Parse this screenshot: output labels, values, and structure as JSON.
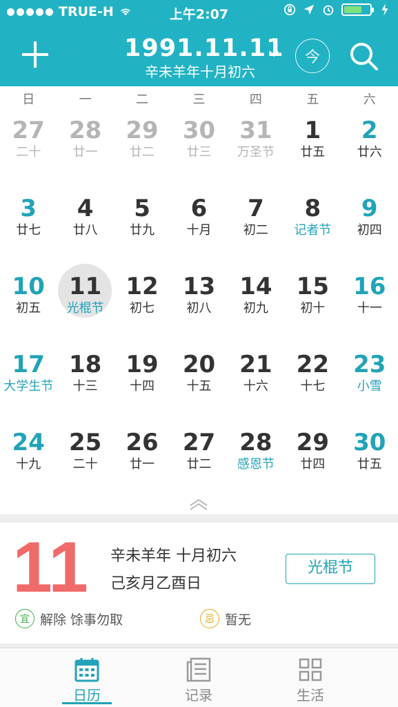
{
  "status_bar": {
    "carrier": "TRUE-H",
    "time": "上午2:07"
  },
  "header": {
    "date": "1991.11.11",
    "lunar": "辛未羊年十月初六",
    "today_label": "今"
  },
  "weekdays": [
    "日",
    "一",
    "二",
    "三",
    "四",
    "五",
    "六"
  ],
  "calendar": {
    "rows": [
      [
        {
          "n": "27",
          "s": "二十",
          "style": "gray"
        },
        {
          "n": "28",
          "s": "廿一",
          "style": "gray"
        },
        {
          "n": "29",
          "s": "廿二",
          "style": "gray"
        },
        {
          "n": "30",
          "s": "廿三",
          "style": "gray"
        },
        {
          "n": "31",
          "s": "万圣节",
          "style": "gray"
        },
        {
          "n": "1",
          "s": "廿五",
          "style": "dark"
        },
        {
          "n": "2",
          "s": "廿六",
          "style": "teal",
          "sub_dark": true
        }
      ],
      [
        {
          "n": "3",
          "s": "廿七",
          "style": "teal",
          "sub_dark": true
        },
        {
          "n": "4",
          "s": "廿八",
          "style": "dark"
        },
        {
          "n": "5",
          "s": "廿九",
          "style": "dark"
        },
        {
          "n": "6",
          "s": "十月",
          "style": "dark"
        },
        {
          "n": "7",
          "s": "初二",
          "style": "dark"
        },
        {
          "n": "8",
          "s": "记者节",
          "style": "dark",
          "sub_teal": true
        },
        {
          "n": "9",
          "s": "初四",
          "style": "teal",
          "sub_dark": true
        }
      ],
      [
        {
          "n": "10",
          "s": "初五",
          "style": "teal",
          "sub_dark": true
        },
        {
          "n": "11",
          "s": "光棍节",
          "style": "dark",
          "sub_teal": true,
          "selected": true
        },
        {
          "n": "12",
          "s": "初七",
          "style": "dark"
        },
        {
          "n": "13",
          "s": "初八",
          "style": "dark"
        },
        {
          "n": "14",
          "s": "初九",
          "style": "dark"
        },
        {
          "n": "15",
          "s": "初十",
          "style": "dark"
        },
        {
          "n": "16",
          "s": "十一",
          "style": "teal",
          "sub_dark": true
        }
      ],
      [
        {
          "n": "17",
          "s": "大学生节",
          "style": "teal"
        },
        {
          "n": "18",
          "s": "十三",
          "style": "dark"
        },
        {
          "n": "19",
          "s": "十四",
          "style": "dark"
        },
        {
          "n": "20",
          "s": "十五",
          "style": "dark"
        },
        {
          "n": "21",
          "s": "十六",
          "style": "dark"
        },
        {
          "n": "22",
          "s": "十七",
          "style": "dark"
        },
        {
          "n": "23",
          "s": "小雪",
          "style": "teal"
        }
      ],
      [
        {
          "n": "24",
          "s": "十九",
          "style": "teal",
          "sub_dark": true
        },
        {
          "n": "25",
          "s": "二十",
          "style": "dark"
        },
        {
          "n": "26",
          "s": "廿一",
          "style": "dark"
        },
        {
          "n": "27",
          "s": "廿二",
          "style": "dark"
        },
        {
          "n": "28",
          "s": "感恩节",
          "style": "dark",
          "sub_teal": true
        },
        {
          "n": "29",
          "s": "廿四",
          "style": "dark"
        },
        {
          "n": "30",
          "s": "廿五",
          "style": "teal",
          "sub_dark": true
        }
      ]
    ]
  },
  "detail": {
    "day": "11",
    "line1": "辛未羊年 十月初六",
    "line2": "己亥月乙酉日",
    "festival": "光棍节",
    "yi_badge": "宜",
    "yi_text": "解除 馀事勿取",
    "ji_badge": "忌",
    "ji_text": "暂无"
  },
  "tabs": [
    {
      "label": "日历",
      "icon": "calendar-icon",
      "active": true
    },
    {
      "label": "记录",
      "icon": "records-icon",
      "active": false
    },
    {
      "label": "生活",
      "icon": "grid-icon",
      "active": false
    }
  ],
  "colors": {
    "primary": "#21b3c3",
    "accent_text": "#21a3b8",
    "big_day": "#f06a6a"
  }
}
